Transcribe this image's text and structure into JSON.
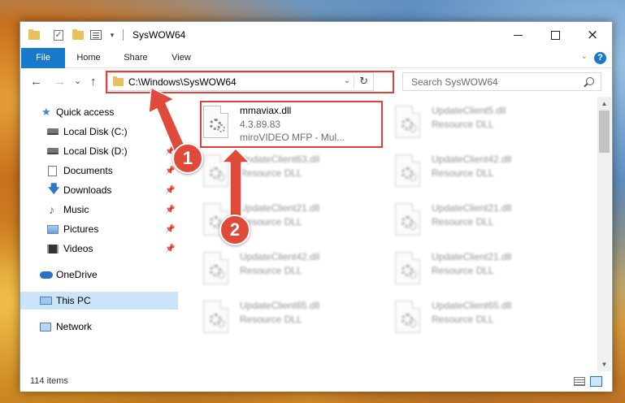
{
  "window": {
    "title": "SysWOW64",
    "controls": {
      "minimize": "minimize-icon",
      "maximize": "maximize-icon",
      "close": "×"
    }
  },
  "ribbon": {
    "tabs": [
      {
        "label": "File"
      },
      {
        "label": "Home"
      },
      {
        "label": "Share"
      },
      {
        "label": "View"
      }
    ],
    "help": "?",
    "expand_icon": "chevron-down-icon"
  },
  "nav": {
    "back": "←",
    "forward": "→",
    "recent": "⌄",
    "up": "↑",
    "address": "C:\\Windows\\SysWOW64",
    "refresh": "↻",
    "search_placeholder": "Search SysWOW64"
  },
  "sidebar": {
    "items": [
      {
        "label": "Quick access",
        "icon": "star-icon"
      },
      {
        "label": "Local Disk (C:)",
        "icon": "drive-icon",
        "pinned": true
      },
      {
        "label": "Local Disk (D:)",
        "icon": "drive-icon",
        "pinned": true
      },
      {
        "label": "Documents",
        "icon": "documents-icon",
        "pinned": true
      },
      {
        "label": "Downloads",
        "icon": "download-icon",
        "pinned": true
      },
      {
        "label": "Music",
        "icon": "music-icon",
        "pinned": true
      },
      {
        "label": "Pictures",
        "icon": "pictures-icon",
        "pinned": true
      },
      {
        "label": "Videos",
        "icon": "videos-icon",
        "pinned": true
      },
      {
        "label": "OneDrive",
        "icon": "cloud-icon"
      },
      {
        "label": "This PC",
        "icon": "computer-icon",
        "selected": true
      },
      {
        "label": "Network",
        "icon": "network-icon"
      }
    ]
  },
  "files": [
    {
      "name": "mmaviax.dll",
      "line1": "4.3.89.83",
      "line2": "miroVIDEO MFP - Mul...",
      "focus": true
    },
    {
      "name": "UpdateClient5.dll",
      "line1": "Resource DLL"
    },
    {
      "name": "UpdateClient63.dll",
      "line1": "Resource DLL"
    },
    {
      "name": "UpdateClient42.dll",
      "line1": "Resource DLL"
    },
    {
      "name": "UpdateClient21.dll",
      "line1": "Resource DLL"
    },
    {
      "name": "UpdateClient21.dll",
      "line1": "Resource DLL"
    },
    {
      "name": "UpdateClient42.dll",
      "line1": "Resource DLL"
    },
    {
      "name": "UpdateClient21.dll",
      "line1": "Resource DLL"
    },
    {
      "name": "UpdateClient65.dll",
      "line1": "Resource DLL"
    },
    {
      "name": "UpdateClient65.dll",
      "line1": "Resource DLL"
    }
  ],
  "status": {
    "items_count": "114 items"
  },
  "annotations": [
    {
      "label": "1",
      "color": "#e04a3a"
    },
    {
      "label": "2",
      "color": "#e04a3a"
    }
  ],
  "colors": {
    "accent": "#1979ca",
    "highlight": "#e0403a",
    "selected": "#cce4f7"
  }
}
